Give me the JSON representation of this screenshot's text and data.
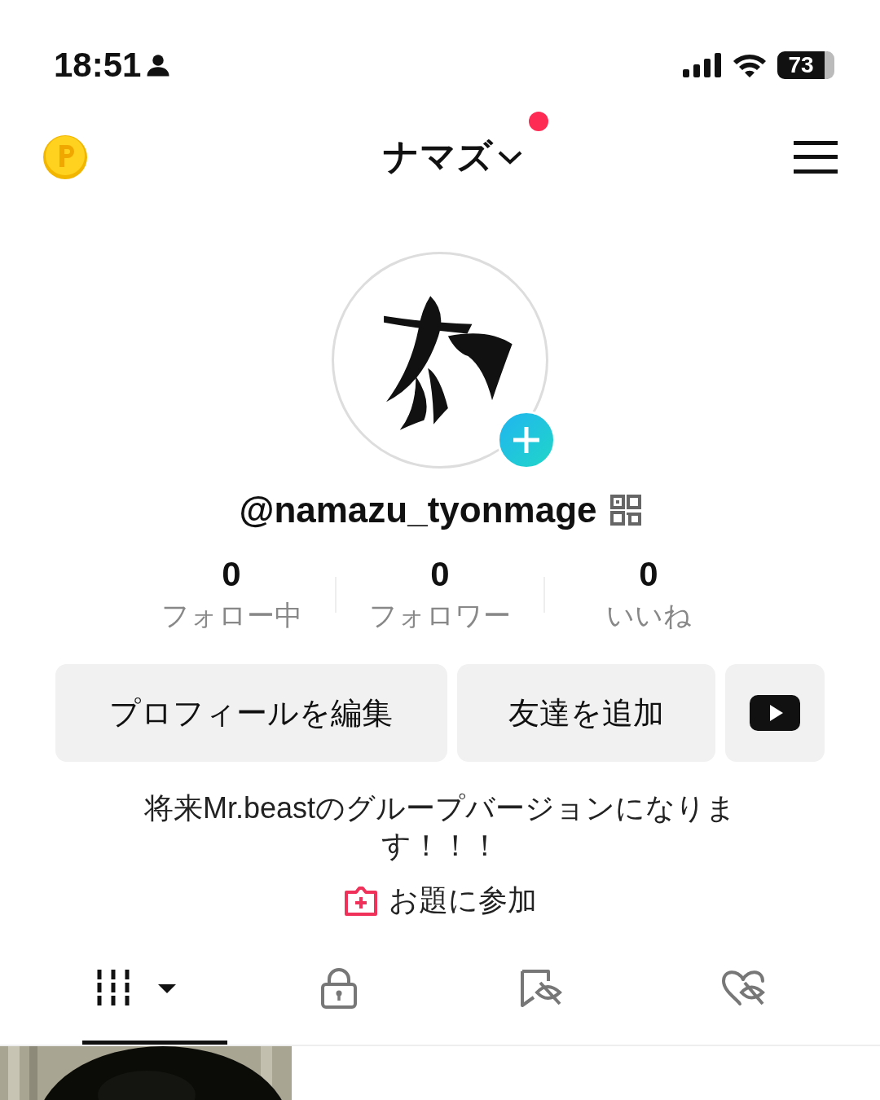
{
  "status_bar": {
    "time": "18:51",
    "battery": "73"
  },
  "header": {
    "title": "ナマズ",
    "has_notification": true
  },
  "profile": {
    "handle": "@namazu_tyonmage"
  },
  "stats": [
    {
      "value": "0",
      "label": "フォロー中"
    },
    {
      "value": "0",
      "label": "フォロワー"
    },
    {
      "value": "0",
      "label": "いいね"
    }
  ],
  "actions": [
    {
      "kind": "text",
      "label": "プロフィールを編集"
    },
    {
      "kind": "text",
      "label": "友達を追加"
    },
    {
      "kind": "youtube"
    }
  ],
  "bio": "将来Mr.beastのグループバージョンになります！！！",
  "challenge_link": "お題に参加",
  "tabs": [
    {
      "kind": "videos",
      "selected": true
    },
    {
      "kind": "private",
      "selected": false
    },
    {
      "kind": "saved",
      "selected": false
    },
    {
      "kind": "liked",
      "selected": false
    }
  ]
}
